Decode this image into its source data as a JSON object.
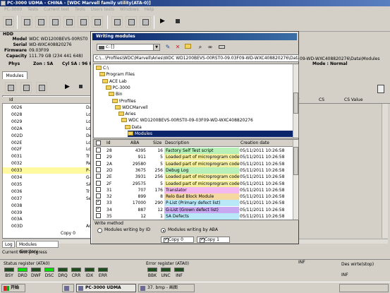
{
  "window": {
    "title": "PC-3000 UDMA - CHINA - [WDC Marvell family utility(ATA-0)]"
  },
  "menu": [
    "PC-3000",
    "Tests",
    "Current test",
    "Tools",
    "Users tests",
    "Windows",
    "Help"
  ],
  "hdd": {
    "section": "HDD",
    "model_label": "Model",
    "model": "WDC WD1200BEVS-00RST0",
    "serial_label": "Serial",
    "serial": "WD-WXC408820276",
    "firmware_label": "Firmware",
    "firmware": "09.03F09",
    "capacity_label": "Capacity",
    "capacity": "111.79 GB (234 441 648)"
  },
  "phys_row": {
    "phys": "Phys",
    "zone": "Zon : SA",
    "cyl": "Cyl SA : 96 (40)",
    "mode": "Mode : Normal",
    "path_right": "09-WD-WXC408820276\\Data\\Modules"
  },
  "modules_tab": "Modules",
  "modules_grid": {
    "id_header": "Id",
    "rows": [
      {
        "id": "0026",
        "t": "Da"
      },
      {
        "id": "0028",
        "t": "Lo"
      },
      {
        "id": "0029",
        "t": "Lo"
      },
      {
        "id": "002A",
        "t": "Lo"
      },
      {
        "id": "002D",
        "t": "De"
      },
      {
        "id": "002E",
        "t": "Lo"
      },
      {
        "id": "002F",
        "t": "Lo"
      },
      {
        "id": "0031",
        "t": "Tr"
      },
      {
        "id": "0032",
        "t": "Re"
      },
      {
        "id": "0033",
        "t": "P-"
      },
      {
        "id": "0034",
        "t": "G-"
      },
      {
        "id": "0035",
        "t": "SA"
      },
      {
        "id": "0036",
        "t": "Tr"
      },
      {
        "id": "0037",
        "t": "Se"
      },
      {
        "id": "0038",
        "t": ""
      },
      {
        "id": "0039",
        "t": ""
      },
      {
        "id": "003A",
        "t": ""
      },
      {
        "id": "003D",
        "t": "Ad"
      }
    ]
  },
  "bg_headers": {
    "r": "r",
    "cs": "CS",
    "csvalue": "CS Value"
  },
  "bottom": {
    "tab_log": "Log",
    "tab_modules_dir": "Modules directory",
    "copy0": "Copy 0",
    "current_test": "Current test progress",
    "status_label": "Status register (ATA0)",
    "error_label": "Error register (ATA0)",
    "leds_status": [
      {
        "name": "BSY",
        "on": false
      },
      {
        "name": "DRD",
        "on": true
      },
      {
        "name": "DWF",
        "on": false
      },
      {
        "name": "DSC",
        "on": true
      },
      {
        "name": "DRQ",
        "on": false
      },
      {
        "name": "CRR",
        "on": false
      },
      {
        "name": "IDX",
        "on": false
      },
      {
        "name": "ERR",
        "on": false
      }
    ],
    "leds_error": [
      {
        "name": "BBK",
        "on": false
      },
      {
        "name": "UNC",
        "on": false
      },
      {
        "name": "INF",
        "on": false
      }
    ],
    "inf": "INF",
    "write_label": "Des wirte(stop)"
  },
  "taskbar": {
    "start": "开始",
    "tasks": [
      {
        "label": "PC-3000 UDMA",
        "active": false
      },
      {
        "label": "PC-3000 UDMA",
        "active": true
      },
      {
        "label": "37. bmp - 画图",
        "active": false
      }
    ]
  },
  "dialog": {
    "title": "Writing modules",
    "drive": "c: []",
    "path": "C:\\...\\Profiles\\WDC\\Marvell\\Aries\\WDC WD1200BEVS-00RST0-09.03F09-WD-WXC408820276\\Data\\Modules",
    "tree": [
      {
        "label": "C:\\",
        "depth": 0,
        "sel": false
      },
      {
        "label": "Program Files",
        "depth": 1,
        "sel": false
      },
      {
        "label": "ACE Lab",
        "depth": 2,
        "sel": false
      },
      {
        "label": "PC-3000",
        "depth": 3,
        "sel": false
      },
      {
        "label": "Bin",
        "depth": 4,
        "sel": false
      },
      {
        "label": "!Profiles",
        "depth": 5,
        "sel": false
      },
      {
        "label": "WDCMarvell",
        "depth": 6,
        "sel": false
      },
      {
        "label": "Aries",
        "depth": 7,
        "sel": false
      },
      {
        "label": "WDC WD1200BEVS-00RST0-09-03F09-WD-WXC408820276",
        "depth": 8,
        "sel": false
      },
      {
        "label": "Data",
        "depth": 9,
        "sel": false
      },
      {
        "label": "Modules",
        "depth": 10,
        "sel": true
      }
    ],
    "columns": {
      "id": "Id",
      "aba": "ABA",
      "size": "Size",
      "desc": "Description",
      "date": "Creation date"
    },
    "rows": [
      {
        "id": "28",
        "aba": "4395",
        "size": "16",
        "desc": "Factory Self Test script",
        "date": "05/11/2011 10:26:58",
        "color": "#b8f0b8",
        "on": false
      },
      {
        "id": "29",
        "aba": "911",
        "size": "5",
        "desc": "Loaded part of microprogram code",
        "date": "05/11/2011 10:26:58",
        "color": "#f4f0a0",
        "on": false
      },
      {
        "id": "2A",
        "aba": "29580",
        "size": "5",
        "desc": "Loaded part of microprogram code",
        "date": "05/11/2011 10:26:58",
        "color": "#f4f0a0",
        "on": false
      },
      {
        "id": "2D",
        "aba": "3675",
        "size": "256",
        "desc": "Debug Log",
        "date": "05/11/2011 10:26:58",
        "color": "#b8f0b8",
        "on": false
      },
      {
        "id": "2E",
        "aba": "3931",
        "size": "256",
        "desc": "Loaded part of microprogram code",
        "date": "05/11/2011 10:26:58",
        "color": "#f4f0a0",
        "on": false
      },
      {
        "id": "2F",
        "aba": "29575",
        "size": "5",
        "desc": "Loaded part of microprogram code",
        "date": "05/11/2011 10:26:58",
        "color": "#f4f0a0",
        "on": false
      },
      {
        "id": "31",
        "aba": "707",
        "size": "176",
        "desc": "Translator",
        "date": "05/11/2011 10:26:58",
        "color": "#f4b8f0",
        "on": false
      },
      {
        "id": "32",
        "aba": "899",
        "size": "8",
        "desc": "Relo Bad Block Module",
        "date": "05/11/2011 10:26:58",
        "color": "#f4d8a0",
        "on": false
      },
      {
        "id": "33",
        "aba": "17000",
        "size": "290",
        "desc": "P-List (Primary defect list)",
        "date": "05/11/2011 10:26:58",
        "color": "#b8e8f8",
        "on": true
      },
      {
        "id": "34",
        "aba": "887",
        "size": "12",
        "desc": "G-List (Grown defect list)",
        "date": "05/11/2011 10:26:58",
        "color": "#c8a8f0",
        "on": true
      },
      {
        "id": "35",
        "aba": "12",
        "size": "1",
        "desc": "SA Defects",
        "date": "05/11/2011 10:26:58",
        "color": "#b8e8f8",
        "on": false
      }
    ],
    "write_method": "Write method",
    "opt_id": "Modules writing by ID",
    "opt_aba": "Modules writing by ABA",
    "copy0": "Copy 0",
    "copy1": "Copy 1"
  }
}
